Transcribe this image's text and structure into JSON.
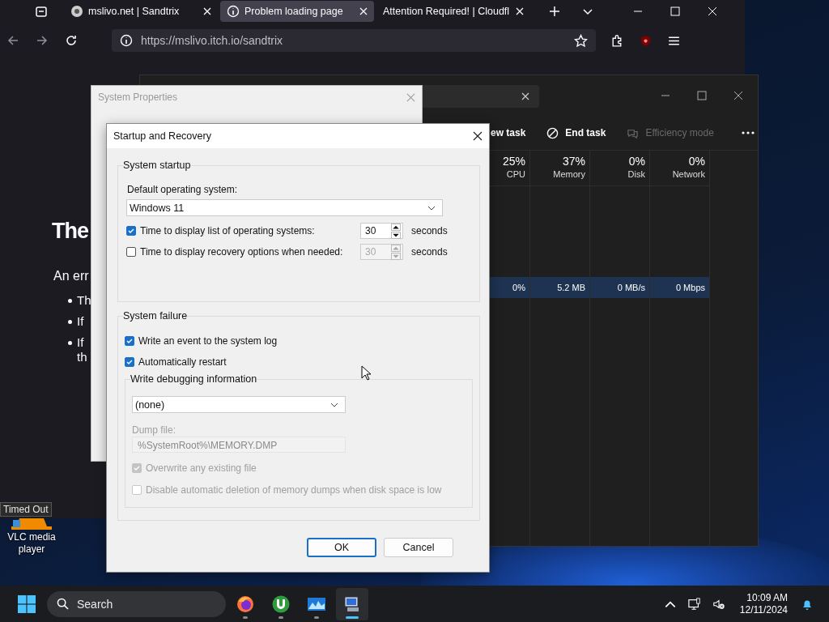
{
  "browser": {
    "tabs": [
      {
        "title": "mslivo.net | Sandtrix",
        "selected": false
      },
      {
        "title": "Problem loading page",
        "selected": true
      },
      {
        "title": "Attention Required! | Cloudfl",
        "selected": false
      }
    ],
    "url": "https://mslivo.itch.io/sandtrix",
    "page": {
      "heading": "The",
      "intro": "An err",
      "bullets": [
        {
          "lines": [
            "Th"
          ]
        },
        {
          "lines": [
            "If"
          ]
        },
        {
          "lines": [
            "If",
            "th"
          ]
        }
      ]
    }
  },
  "task_manager": {
    "toolbar": [
      {
        "kind": "run",
        "label": "ew task",
        "disabled": false
      },
      {
        "kind": "end",
        "label": "End task",
        "disabled": false
      },
      {
        "kind": "efficiency",
        "label": "Efficiency mode",
        "disabled": true
      }
    ],
    "columns": [
      {
        "value": "25%",
        "label": "CPU"
      },
      {
        "value": "37%",
        "label": "Memory"
      },
      {
        "value": "0%",
        "label": "Disk"
      },
      {
        "value": "0%",
        "label": "Network"
      }
    ],
    "selected_row": {
      "values": [
        "0%",
        "5.2 MB",
        "0 MB/s",
        "0 Mbps"
      ]
    }
  },
  "system_properties": {
    "title": "System Properties"
  },
  "dialog": {
    "title": "Startup and Recovery",
    "startup": {
      "legend": "System startup",
      "default_os_label": "Default operating system:",
      "default_os": "Windows 11",
      "options": [
        {
          "label": "Time to display list of operating systems:",
          "checked": true,
          "value": "30",
          "unit": "seconds",
          "spinner_disabled": false
        },
        {
          "label": "Time to display recovery options when needed:",
          "checked": false,
          "value": "30",
          "unit": "seconds",
          "spinner_disabled": true
        }
      ]
    },
    "failure": {
      "legend": "System failure",
      "options": [
        {
          "label": "Write an event to the system log",
          "checked": true
        },
        {
          "label": "Automatically restart",
          "checked": true
        }
      ],
      "debug": {
        "legend": "Write debugging information",
        "type": "(none)",
        "dump_label": "Dump file:",
        "dump_path": "%SystemRoot%\\MEMORY.DMP",
        "options": [
          {
            "label": "Overwrite any existing file",
            "checked": true,
            "disabled": true
          },
          {
            "label": "Disable automatic deletion of memory dumps when disk space is low",
            "checked": false,
            "disabled": true
          }
        ]
      }
    },
    "buttons": [
      {
        "label": "OK",
        "default": true
      },
      {
        "label": "Cancel",
        "default": false
      }
    ]
  },
  "desktop": {
    "tooltip": "Timed Out",
    "icons": [
      {
        "label": "VLC media player"
      }
    ]
  },
  "taskbar": {
    "search_label": "Search",
    "apps": [
      {
        "kind": "firefox",
        "selected": false
      },
      {
        "kind": "torrent",
        "selected": false
      },
      {
        "kind": "monitor",
        "selected": false
      },
      {
        "kind": "system",
        "selected": true
      }
    ],
    "time": "10:09 AM",
    "date": "12/11/2024"
  }
}
